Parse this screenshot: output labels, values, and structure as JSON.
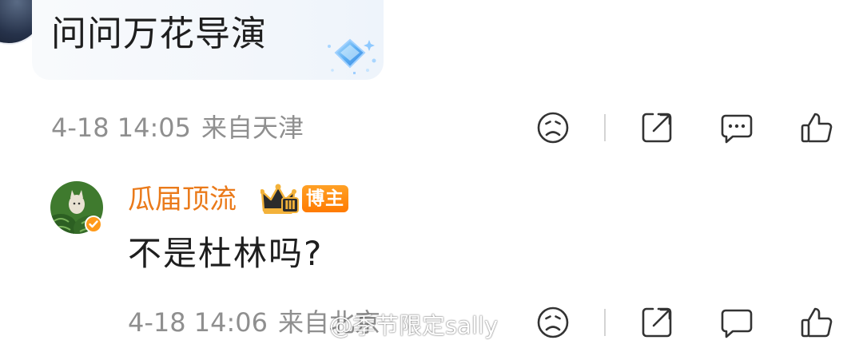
{
  "parent_comment": {
    "text": "问问万花导演",
    "date": "4-18 14:05",
    "location": "来自天津"
  },
  "reply": {
    "username": "瓜届顶流",
    "badge_label": "博主",
    "crown_level": "Ⅲ",
    "text": "不是杜林吗?",
    "date": "4-18 14:06",
    "location": "来自北京"
  },
  "watermark": "@季节限定sally",
  "icons": {
    "dislike": "sad-face-icon",
    "share": "share-icon",
    "comment": "comment-bubble-icon",
    "like": "thumbs-up-icon"
  },
  "colors": {
    "username": "#ea7a1a",
    "meta_text": "#8f8f8f",
    "badge": "#ff8a00",
    "bubble": "#f2f6fb"
  }
}
